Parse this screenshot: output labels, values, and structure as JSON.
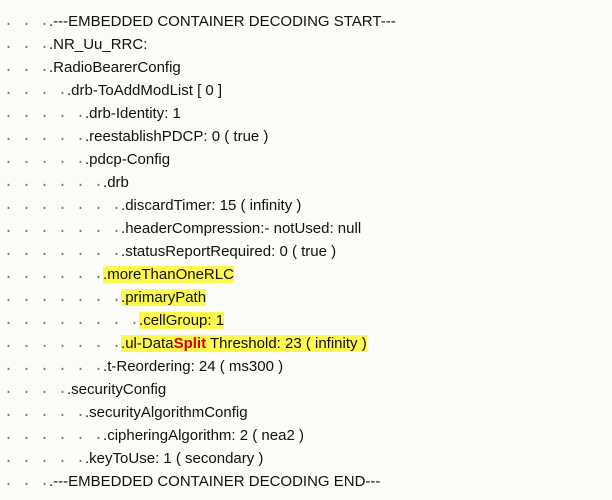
{
  "rows": [
    {
      "indent": 3,
      "parts": [
        {
          "t": ".---EMBEDDED CONTAINER DECODING START---"
        }
      ]
    },
    {
      "indent": 3,
      "parts": [
        {
          "t": ".NR_Uu_RRC:"
        }
      ]
    },
    {
      "indent": 3,
      "parts": [
        {
          "t": ".RadioBearerConfig"
        }
      ]
    },
    {
      "indent": 4,
      "parts": [
        {
          "t": ".drb-ToAddModList [ 0 ]"
        }
      ]
    },
    {
      "indent": 5,
      "parts": [
        {
          "t": ".drb-Identity: 1"
        }
      ]
    },
    {
      "indent": 5,
      "parts": [
        {
          "t": ".reestablishPDCP: 0 ( true )"
        }
      ]
    },
    {
      "indent": 5,
      "parts": [
        {
          "t": ".pdcp-Config"
        }
      ]
    },
    {
      "indent": 6,
      "parts": [
        {
          "t": ".drb"
        }
      ]
    },
    {
      "indent": 7,
      "parts": [
        {
          "t": ".discardTimer: 15 ( infinity )"
        }
      ]
    },
    {
      "indent": 7,
      "parts": [
        {
          "t": ".headerCompression:- notUsed: null"
        }
      ]
    },
    {
      "indent": 7,
      "parts": [
        {
          "t": ".statusReportRequired: 0 ( true )"
        }
      ]
    },
    {
      "indent": 6,
      "parts": [
        {
          "t": ".moreThanOneRLC",
          "hl": true
        }
      ]
    },
    {
      "indent": 7,
      "parts": [
        {
          "t": ".primaryPath",
          "hl": true
        }
      ]
    },
    {
      "indent": 8,
      "parts": [
        {
          "t": ".cellGroup: 1",
          "hl": true
        }
      ]
    },
    {
      "indent": 7,
      "parts": [
        {
          "t": ".ul-Data",
          "hl": true
        },
        {
          "t": "Split",
          "hl": true,
          "red": true
        },
        {
          "t": " Threshold: 23 ( infinity )",
          "hl": true
        }
      ]
    },
    {
      "indent": 6,
      "parts": [
        {
          "t": ".t-Reordering: 24 ( ms300 )"
        }
      ]
    },
    {
      "indent": 4,
      "parts": [
        {
          "t": ".securityConfig"
        }
      ]
    },
    {
      "indent": 5,
      "parts": [
        {
          "t": ".securityAlgorithmConfig"
        }
      ]
    },
    {
      "indent": 6,
      "parts": [
        {
          "t": ".cipheringAlgorithm: 2 ( nea2 )"
        }
      ]
    },
    {
      "indent": 5,
      "parts": [
        {
          "t": ".keyToUse: 1 ( secondary )"
        }
      ]
    },
    {
      "indent": 3,
      "parts": [
        {
          "t": ".---EMBEDDED CONTAINER DECODING END---"
        }
      ]
    }
  ],
  "dot_unit": ".   "
}
